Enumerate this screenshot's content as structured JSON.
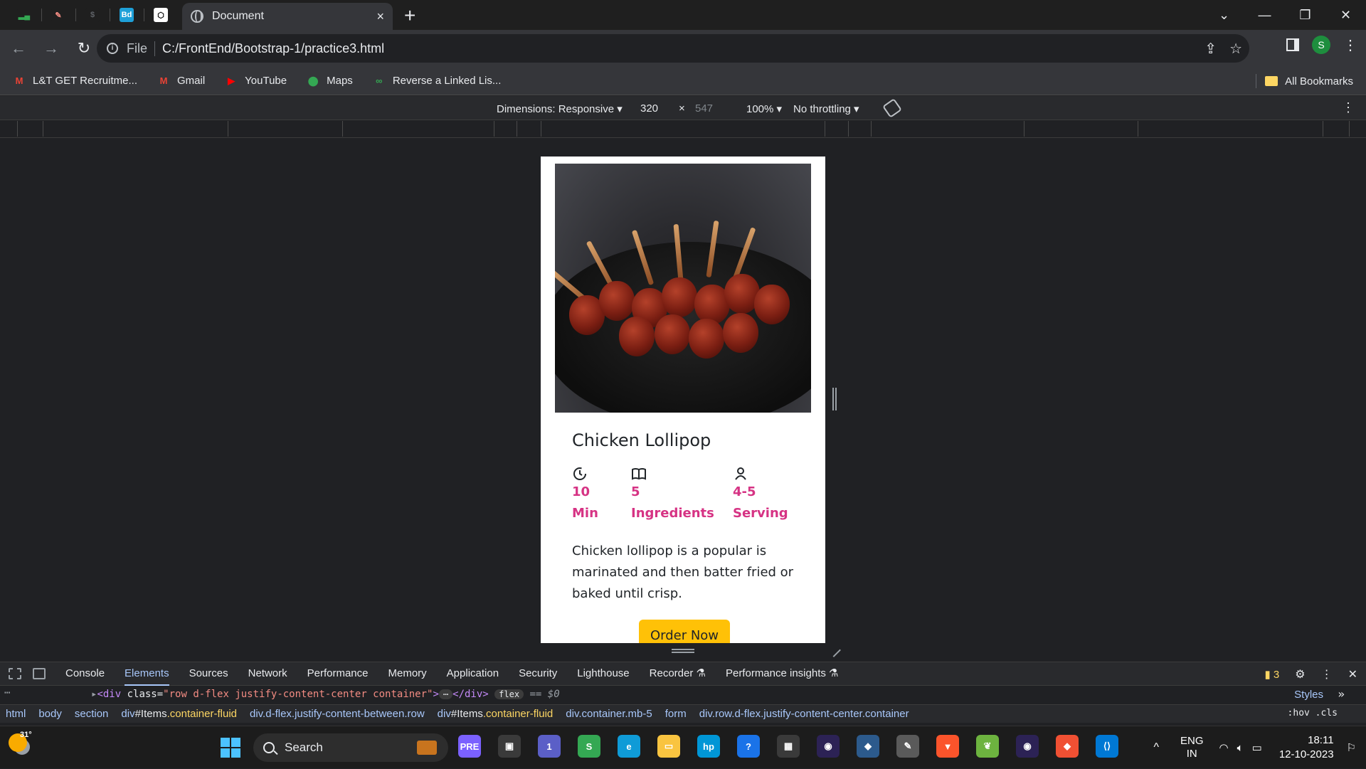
{
  "browser": {
    "tab_title": "Document",
    "new_tab_label": "+",
    "tab_close": "×",
    "minimize": "—",
    "restore": "❐",
    "close": "✕",
    "tab_list": "⌄",
    "profile_initial": "S",
    "favicons": [
      {
        "icon": "chart-icon",
        "glyph": "▂▄",
        "bg": "#1f1f1f",
        "fg": "#34a853"
      },
      {
        "icon": "feather-icon",
        "glyph": "✎",
        "bg": "#1f1f1f",
        "fg": "#f28b82"
      },
      {
        "icon": "dollar-icon",
        "glyph": "$",
        "bg": "#1f1f1f",
        "fg": "#5f6368"
      },
      {
        "icon": "bd-icon",
        "glyph": "Bd",
        "bg": "#1ea0d8",
        "fg": "#ffffff"
      },
      {
        "icon": "codepen-icon",
        "glyph": "⬡",
        "bg": "#ffffff",
        "fg": "#000000"
      }
    ]
  },
  "address_bar": {
    "scheme_label": "File",
    "url": "C:/FrontEnd/Bootstrap-1/practice3.html"
  },
  "bookmarks": {
    "items": [
      {
        "label": "L&T GET Recruitme...",
        "icon": "gmail-icon",
        "glyph": "M",
        "color": "#ea4335"
      },
      {
        "label": "Gmail",
        "icon": "gmail-icon",
        "glyph": "M",
        "color": "#ea4335"
      },
      {
        "label": "YouTube",
        "icon": "youtube-icon",
        "glyph": "▶",
        "color": "#ff0000"
      },
      {
        "label": "Maps",
        "icon": "maps-pin-icon",
        "glyph": "⬤",
        "color": "#34a853"
      },
      {
        "label": "Reverse a Linked Lis...",
        "icon": "link-icon",
        "glyph": "∞",
        "color": "#34a853"
      }
    ],
    "all_label": "All Bookmarks"
  },
  "device_toolbar": {
    "dimensions_label": "Dimensions: Responsive",
    "width": "320",
    "separator": "×",
    "height": "547",
    "zoom": "100%",
    "throttling": "No throttling"
  },
  "card": {
    "title": "Chicken Lollipop",
    "stats": [
      {
        "icon": "clock-history-icon",
        "value": "10",
        "unit": "Min"
      },
      {
        "icon": "book-icon",
        "value": "5",
        "unit": "Ingredients"
      },
      {
        "icon": "person-icon",
        "value": "4-5",
        "unit": "Serving"
      }
    ],
    "description": "Chicken lollipop is a popular is marinated and then batter fried or baked until crisp.",
    "button_label": "Order Now",
    "accent_color": "#d63384",
    "button_color": "#ffc107"
  },
  "devtools": {
    "tabs": [
      "Console",
      "Elements",
      "Sources",
      "Network",
      "Performance",
      "Memory",
      "Application",
      "Security",
      "Lighthouse",
      "Recorder ⚗",
      "Performance insights ⚗"
    ],
    "active_tab": "Elements",
    "issues_count": "3",
    "code_line": {
      "open": "<div",
      "attr_name": "class=",
      "attr_value": "\"row d-flex justify-content-center container\"",
      "close_open": ">",
      "ellipsis": "⋯",
      "close_tag": "</div>",
      "badge": "flex",
      "suffix": "== $0"
    },
    "styles_label": "Styles",
    "hov_label": ":hov  .cls",
    "breadcrumbs": [
      {
        "tag": "html",
        "id": "",
        "cls": ""
      },
      {
        "tag": "body",
        "id": "",
        "cls": ""
      },
      {
        "tag": "section",
        "id": "",
        "cls": ""
      },
      {
        "tag": "div",
        "id": "#Items",
        "cls": ".container-fluid"
      },
      {
        "tag": "div.d-flex.justify-content-between.row",
        "id": "",
        "cls": ""
      },
      {
        "tag": "div",
        "id": "#Items",
        "cls": ".container-fluid"
      },
      {
        "tag": "div.container.mb-5",
        "id": "",
        "cls": ""
      },
      {
        "tag": "form",
        "id": "",
        "cls": ""
      },
      {
        "tag": "div.row.d-flex.justify-content-center.container",
        "id": "",
        "cls": ""
      }
    ]
  },
  "taskbar": {
    "temperature": "31°",
    "search_label": "Search",
    "apps": [
      {
        "icon": "copilot-icon",
        "glyph": "PRE",
        "bg": "#7b61ff"
      },
      {
        "icon": "task-view-icon",
        "glyph": "▣",
        "bg": "#3a3a3a"
      },
      {
        "icon": "teams-chat-icon",
        "glyph": "1",
        "bg": "#5b5fc7"
      },
      {
        "icon": "chrome-icon",
        "glyph": "S",
        "bg": "#34a853"
      },
      {
        "icon": "edge-icon",
        "glyph": "e",
        "bg": "#0f9bd7"
      },
      {
        "icon": "file-explorer-icon",
        "glyph": "▭",
        "bg": "#f9c440"
      },
      {
        "icon": "myhp-icon",
        "glyph": "hp",
        "bg": "#0096d6"
      },
      {
        "icon": "help-icon",
        "glyph": "?",
        "bg": "#1a73e8"
      },
      {
        "icon": "store-icon",
        "glyph": "▦",
        "bg": "#3a3a3a"
      },
      {
        "icon": "eclipse-icon",
        "glyph": "◉",
        "bg": "#2c2255"
      },
      {
        "icon": "mysql-icon",
        "glyph": "◆",
        "bg": "#2c5a8c"
      },
      {
        "icon": "notepad-icon",
        "glyph": "✎",
        "bg": "#5a5a5a"
      },
      {
        "icon": "brave-icon",
        "glyph": "▼",
        "bg": "#fb542b"
      },
      {
        "icon": "spring-icon",
        "glyph": "❦",
        "bg": "#6db33f"
      },
      {
        "icon": "eclipse-ide-icon",
        "glyph": "◉",
        "bg": "#2c2255"
      },
      {
        "icon": "git-icon",
        "glyph": "◆",
        "bg": "#f05033"
      },
      {
        "icon": "vscode-icon",
        "glyph": "⟨⟩",
        "bg": "#0078d4"
      }
    ],
    "lang_line1": "ENG",
    "lang_line2": "IN",
    "time": "18:11",
    "date": "12-10-2023"
  }
}
